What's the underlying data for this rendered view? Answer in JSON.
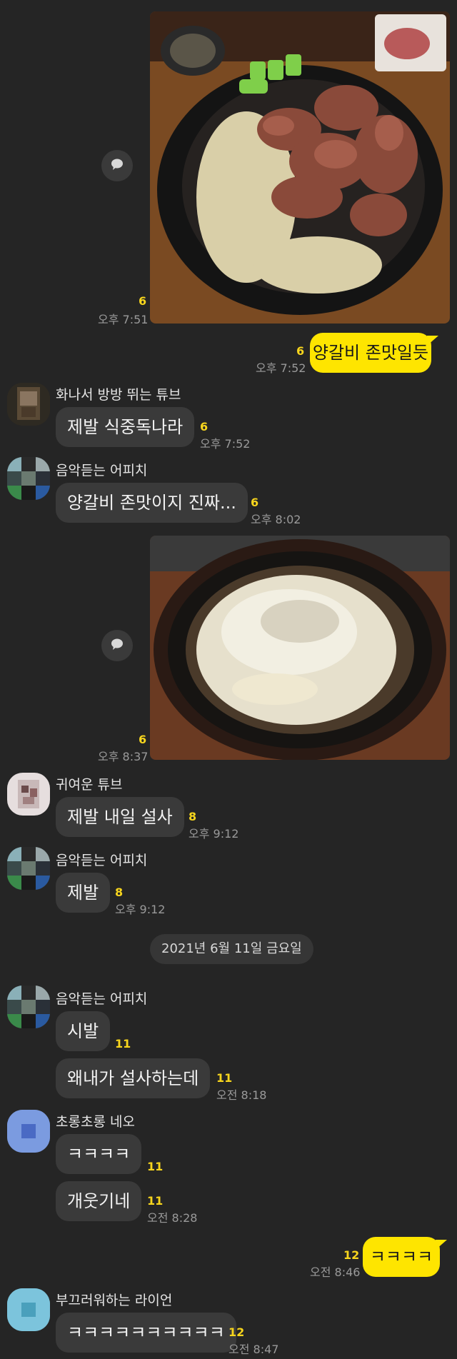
{
  "colors": {
    "background": "#252525",
    "bubble_other": "#3a3a3a",
    "bubble_me": "#fee500",
    "unread_count": "#f7d51d"
  },
  "messages": {
    "m1": {
      "type": "photo",
      "count": "6",
      "time": "오후 7:51",
      "share_icon": "speech-bubble-icon"
    },
    "m2": {
      "text": "양갈비 존맛일듯",
      "count": "6",
      "time": "오후 7:52"
    },
    "m3": {
      "sender": "화나서 방방 뛰는 튜브",
      "text": "제발 식중독나라",
      "count": "6",
      "time": "오후 7:52"
    },
    "m4": {
      "sender": "음악듣는 어피치",
      "text": "양갈비 존맛이지 진짜...",
      "count": "6",
      "time": "오후 8:02"
    },
    "m5": {
      "type": "photo",
      "count": "6",
      "time": "오후 8:37",
      "share_icon": "speech-bubble-icon"
    },
    "m6": {
      "sender": "귀여운 튜브",
      "text": "제발 내일 설사",
      "count": "8",
      "time": "오후 9:12"
    },
    "m7": {
      "sender": "음악듣는 어피치",
      "text": "제발",
      "count": "8",
      "time": "오후 9:12"
    },
    "date": "2021년 6월 11일 금요일",
    "m8": {
      "sender": "음악듣는 어피치",
      "text": "시발",
      "count": "11"
    },
    "m9": {
      "text": "왜내가 설사하는데",
      "count": "11",
      "time": "오전 8:18"
    },
    "m10": {
      "sender": "초롱초롱 네오",
      "text": "ㅋㅋㅋㅋ",
      "count": "11"
    },
    "m11": {
      "text": "개웃기네",
      "count": "11",
      "time": "오전 8:28"
    },
    "m12": {
      "text": "ㅋㅋㅋㅋ",
      "count": "12",
      "time": "오전 8:46"
    },
    "m13": {
      "sender": "부끄러워하는 라이언",
      "text": "ㅋㅋㅋㅋㅋㅋㅋㅋㅋㅋ",
      "count": "12",
      "time": "오전 8:47"
    }
  }
}
